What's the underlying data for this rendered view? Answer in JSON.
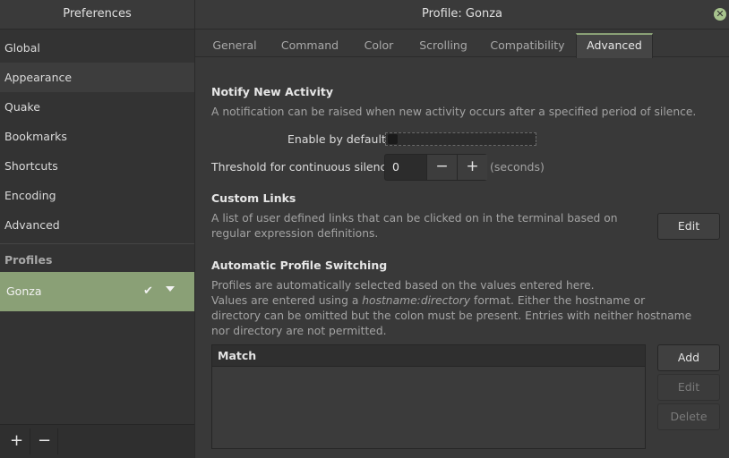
{
  "sidebar": {
    "title": "Preferences",
    "items": [
      {
        "label": "Global"
      },
      {
        "label": "Appearance"
      },
      {
        "label": "Quake"
      },
      {
        "label": "Bookmarks"
      },
      {
        "label": "Shortcuts"
      },
      {
        "label": "Encoding"
      },
      {
        "label": "Advanced"
      }
    ],
    "selected_item": "Appearance",
    "profiles_label": "Profiles",
    "profile_name": "Gonza",
    "add_label": "+",
    "remove_label": "−"
  },
  "header": {
    "title": "Profile: Gonza",
    "close_glyph": "✕"
  },
  "tabs": [
    {
      "label": "General"
    },
    {
      "label": "Command"
    },
    {
      "label": "Color"
    },
    {
      "label": "Scrolling"
    },
    {
      "label": "Compatibility"
    },
    {
      "label": "Advanced"
    }
  ],
  "active_tab": "Advanced",
  "notify": {
    "heading": "Notify New Activity",
    "description": "A notification can be raised when new activity occurs after a specified period of silence.",
    "enable_label": "Enable by default",
    "enabled": false,
    "threshold_label": "Threshold for continuous silence",
    "threshold_value": "0",
    "minus": "−",
    "plus": "+",
    "unit": "(seconds)"
  },
  "custom_links": {
    "heading": "Custom Links",
    "description_line1": "A list of user defined links that can be clicked on in the terminal based on",
    "description_line2": "regular expression definitions.",
    "edit_label": "Edit"
  },
  "auto_switch": {
    "heading": "Automatic Profile Switching",
    "line1": "Profiles are automatically selected based on the values entered here.",
    "line2_pre": "Values are entered using a ",
    "line2_em": "hostname:directory",
    "line2_post": " format. Either the hostname or",
    "line3": "directory can be omitted but the colon must be present. Entries with neither hostname",
    "line4": "nor directory are not permitted.",
    "column_match": "Match",
    "add_label": "Add",
    "edit_label": "Edit",
    "delete_label": "Delete"
  },
  "colors": {
    "accent": "#8aa076",
    "background": "#393939"
  }
}
